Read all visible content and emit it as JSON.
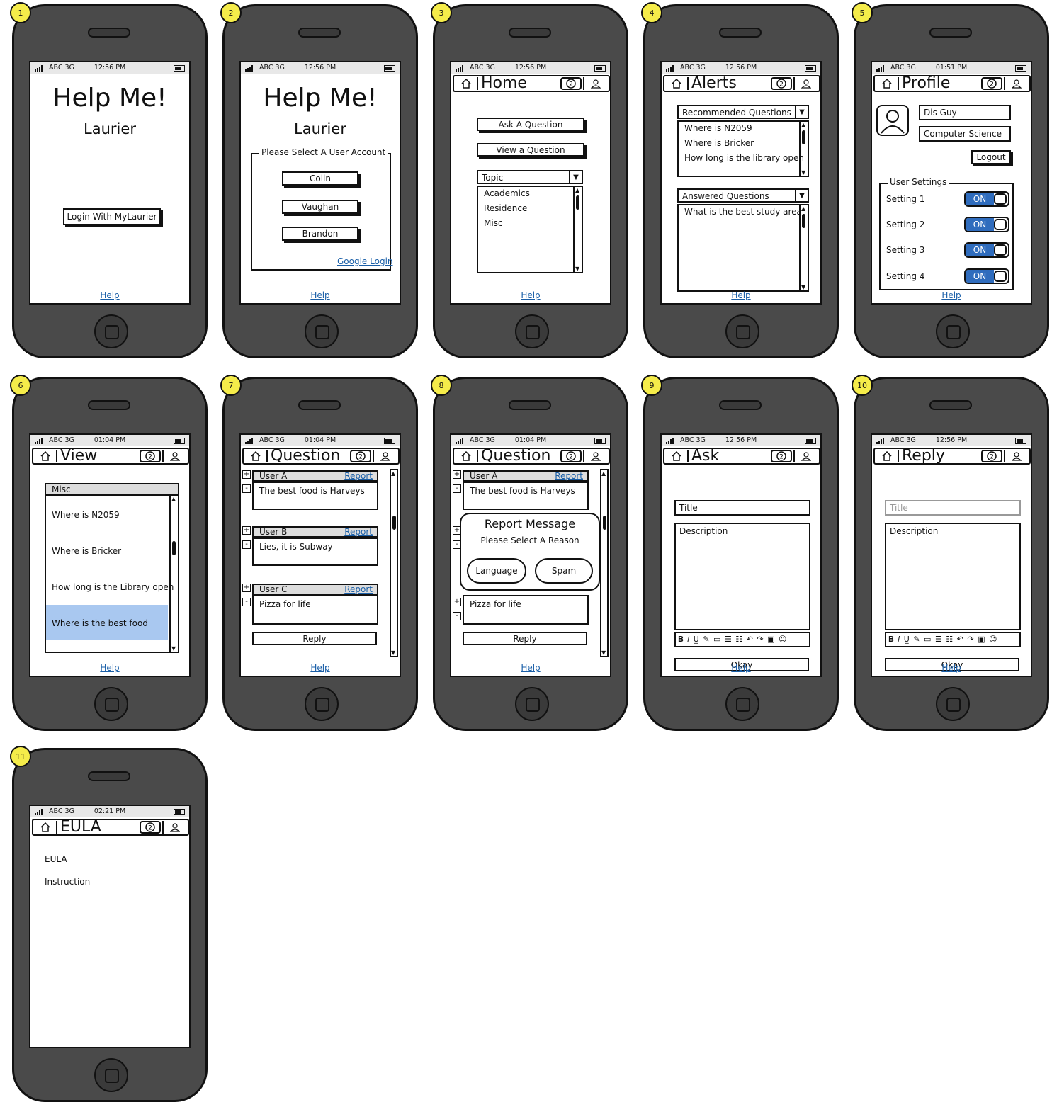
{
  "status": {
    "carrier": "ABC 3G"
  },
  "help_label": "Help",
  "screens": {
    "s1": {
      "badge": "1",
      "time": "12:56 PM",
      "title": "Help Me!",
      "subtitle": "Laurier",
      "login_button": "Login With MyLaurier"
    },
    "s2": {
      "badge": "2",
      "time": "12:56 PM",
      "title": "Help Me!",
      "subtitle": "Laurier",
      "group_label": "Please Select A User Account",
      "accounts": [
        "Colin",
        "Vaughan",
        "Brandon"
      ],
      "google_login": "Google Login"
    },
    "s3": {
      "badge": "3",
      "time": "12:56 PM",
      "nav_title": "Home",
      "ask_button": "Ask A Question",
      "view_button": "View a Question",
      "topic_label": "Topic",
      "topics": [
        "Academics",
        "Residence",
        "Misc"
      ]
    },
    "s4": {
      "badge": "4",
      "time": "12:56 PM",
      "nav_title": "Alerts",
      "recommended_label": "Recommended Questions",
      "recommended": [
        "Where is N2059",
        "Where is Bricker",
        "How long is the library open"
      ],
      "answered_label": "Answered Questions",
      "answered": [
        "What is the best study area"
      ]
    },
    "s5": {
      "badge": "5",
      "time": "01:51 PM",
      "nav_title": "Profile",
      "name": "Dis Guy",
      "program": "Computer Science",
      "logout_button": "Logout",
      "settings_label": "User Settings",
      "settings": [
        {
          "label": "Setting 1",
          "state": "ON"
        },
        {
          "label": "Setting 2",
          "state": "ON"
        },
        {
          "label": "Setting 3",
          "state": "ON"
        },
        {
          "label": "Setting 4",
          "state": "ON"
        }
      ]
    },
    "s6": {
      "badge": "6",
      "time": "01:04 PM",
      "nav_title": "View",
      "list_header": "Misc",
      "items": [
        "Where is N2059",
        "Where is Bricker",
        "How long is the Library open",
        "Where is the best food"
      ]
    },
    "s7": {
      "badge": "7",
      "time": "01:04 PM",
      "nav_title": "Question",
      "report_label": "Report",
      "posts": [
        {
          "user": "User A",
          "text": "The best food is Harveys"
        },
        {
          "user": "User B",
          "text": "Lies, it is Subway"
        },
        {
          "user": "User C",
          "text": "Pizza for life"
        }
      ],
      "reply_button": "Reply"
    },
    "s8": {
      "badge": "8",
      "time": "01:04 PM",
      "nav_title": "Question",
      "report_label": "Report",
      "post_a_user": "User A",
      "post_a_text": "The best food is Harveys",
      "post_c_text": "Pizza for life",
      "dialog_title": "Report Message",
      "dialog_subtitle": "Please Select A Reason",
      "reason_language": "Language",
      "reason_spam": "Spam",
      "reply_button": "Reply"
    },
    "s9": {
      "badge": "9",
      "time": "12:56 PM",
      "nav_title": "Ask",
      "title_value": "Title",
      "description_value": "Description",
      "okay_button": "Okay"
    },
    "s10": {
      "badge": "10",
      "time": "12:56 PM",
      "nav_title": "Reply",
      "title_placeholder": "Title",
      "description_value": "Description",
      "okay_button": "Okay"
    },
    "s11": {
      "badge": "11",
      "time": "02:21 PM",
      "nav_title": "EULA",
      "line1": "EULA",
      "line2": "Instruction"
    }
  },
  "icons": [
    "signal-icon",
    "battery-icon",
    "home-icon",
    "question-icon",
    "user-icon",
    "avatar-icon"
  ],
  "colors": {
    "phone_body": "#4a4a4a",
    "badge": "#f5ec4a",
    "toggle_on": "#2f6cbd",
    "selected_row": "#a9c8f0",
    "link": "#1a5fa8"
  }
}
